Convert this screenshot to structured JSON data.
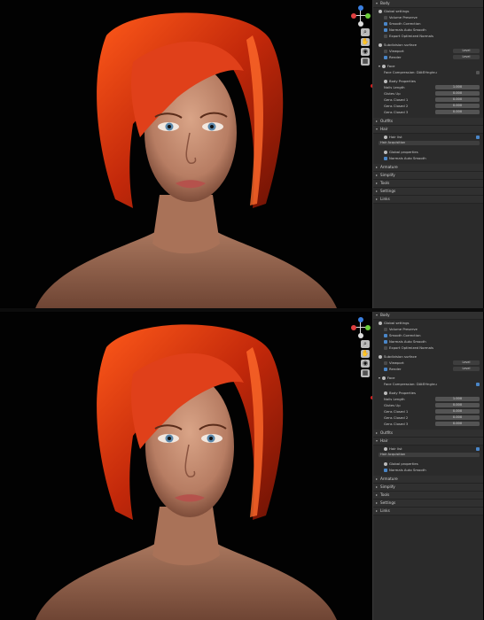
{
  "gizmo": {
    "colors": {
      "x": "#e04040",
      "y": "#6ccf3a",
      "z": "#3a7fe0",
      "center": "#dddddd"
    }
  },
  "tools": [
    "zoom-icon",
    "hand-icon",
    "camera-icon",
    "grid-icon"
  ],
  "panes": [
    {
      "body_title": "Body",
      "global_settings": "Global settings",
      "volume_preserve": "Volume Preserve",
      "smooth_correction": "Smooth Correction",
      "normals_auto_smooth": "Normals Auto Smooth",
      "export_optimized_normals": "Export Optimized Normals",
      "subdivision_surface": "Subdivision surface",
      "viewport": "Viewport",
      "viewport_level": "Level",
      "render": "Render",
      "render_level": "Level",
      "face": "Face",
      "face_compression": "Face Compression: DAtEHnginu",
      "face_compression_checked": false,
      "body_properties": "Body Properties",
      "props": [
        {
          "label": "Nails Length",
          "value": "1.000"
        },
        {
          "label": "Glutes Up",
          "value": "0.000"
        },
        {
          "label": "Gens Closed 1",
          "value": "0.000"
        },
        {
          "label": "Gens Closed 2",
          "value": "0.000"
        },
        {
          "label": "Gens Closed 3",
          "value": "0.000"
        }
      ],
      "outfits": "Outfits",
      "hair": "Hair",
      "hair_list": "Hair list",
      "hair_acquisition": "Hair Acquisition",
      "global_properties": "Global properties",
      "hair_normals": "Normals Auto Smooth",
      "armature": "Armature",
      "simplify": "Simplify",
      "tools_label": "Tools",
      "settings": "Settings",
      "links": "Links"
    },
    {
      "body_title": "Body",
      "global_settings": "Global settings",
      "volume_preserve": "Volume Preserve",
      "smooth_correction": "Smooth Correction",
      "normals_auto_smooth": "Normals Auto Smooth",
      "export_optimized_normals": "Export Optimized Normals",
      "subdivision_surface": "Subdivision surface",
      "viewport": "Viewport",
      "viewport_level": "Level",
      "render": "Render",
      "render_level": "Level",
      "face": "Face",
      "face_compression": "Face Compression: DAtEHnginu",
      "face_compression_checked": true,
      "body_properties": "Body Properties",
      "props": [
        {
          "label": "Nails Length",
          "value": "1.000"
        },
        {
          "label": "Glutes Up",
          "value": "0.000"
        },
        {
          "label": "Gens Closed 1",
          "value": "0.000"
        },
        {
          "label": "Gens Closed 2",
          "value": "0.000"
        },
        {
          "label": "Gens Closed 3",
          "value": "0.000"
        }
      ],
      "outfits": "Outfits",
      "hair": "Hair",
      "hair_list": "Hair list",
      "hair_acquisition": "Hair Acquisition",
      "global_properties": "Global properties",
      "hair_normals": "Normals Auto Smooth",
      "armature": "Armature",
      "simplify": "Simplify",
      "tools_label": "Tools",
      "settings": "Settings",
      "links": "Links"
    }
  ]
}
